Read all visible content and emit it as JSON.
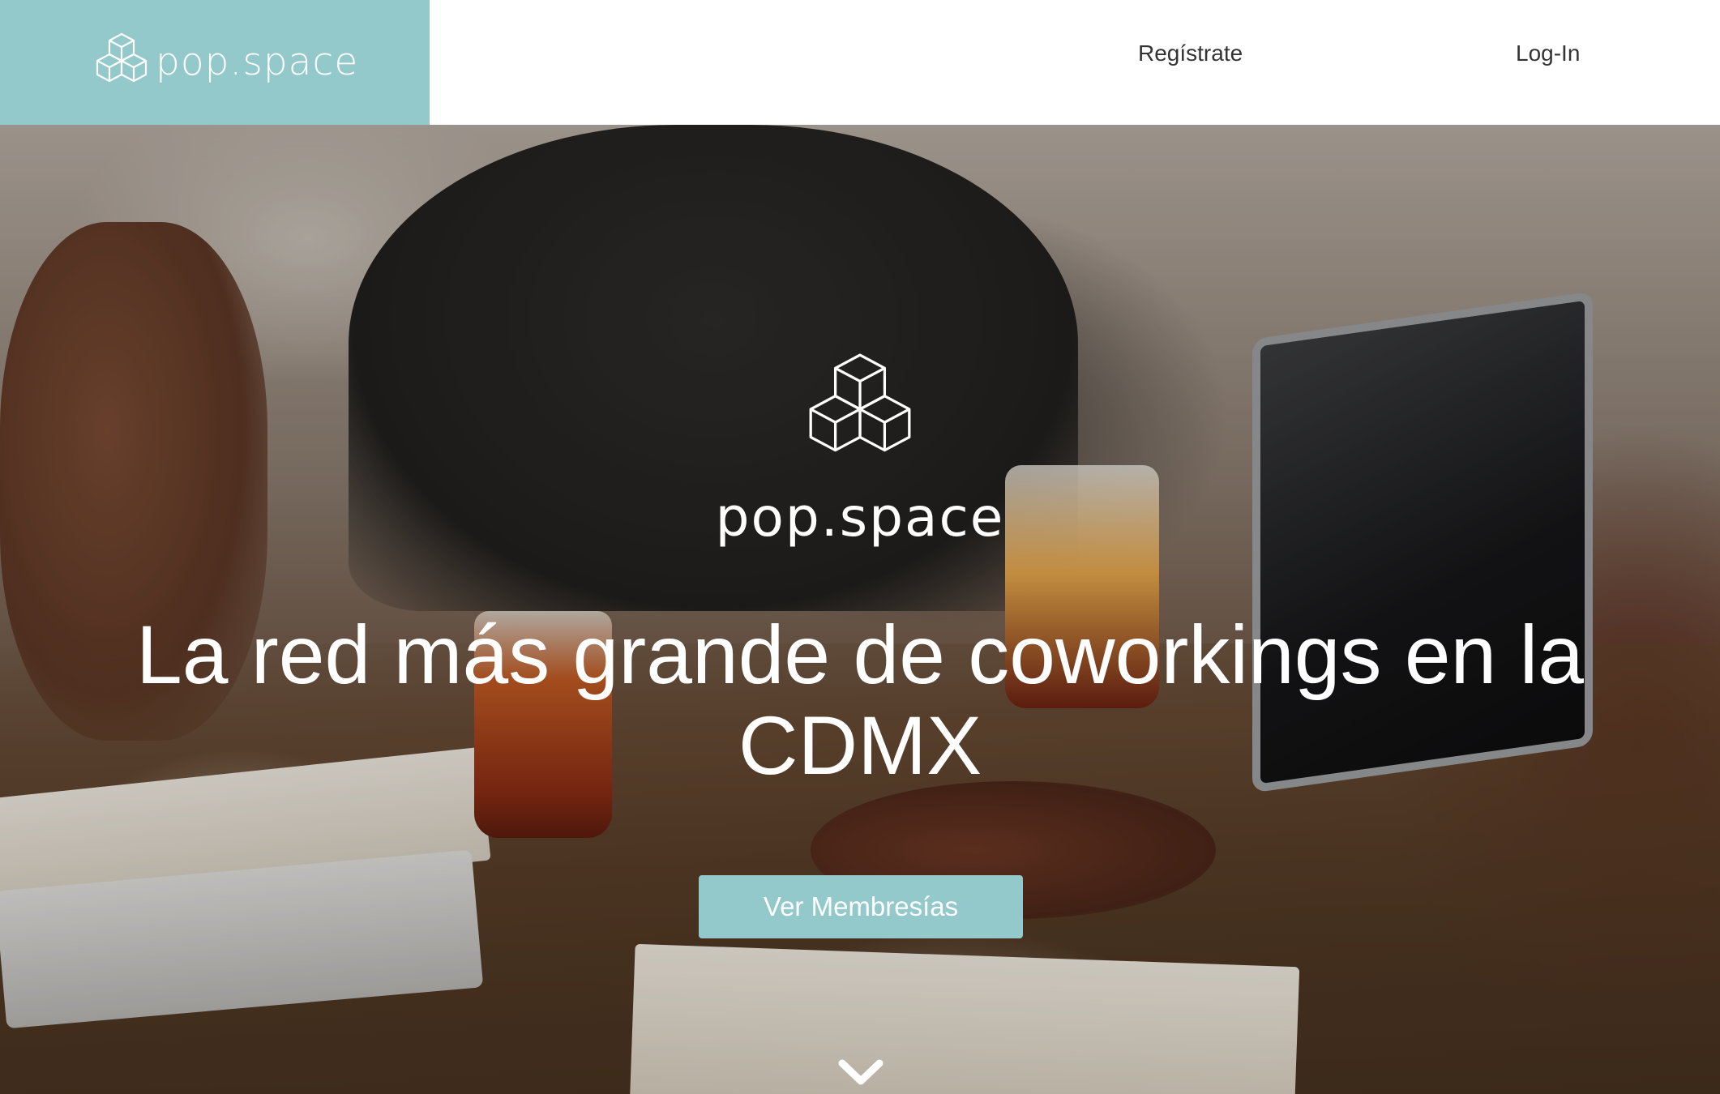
{
  "header": {
    "brand": "pop.space",
    "nav": {
      "register_label": "Regístrate",
      "login_label": "Log-In"
    }
  },
  "hero": {
    "brand": "pop.space",
    "headline": "La red más grande de coworkings en la CDMX",
    "cta_label": "Ver Membresías",
    "logo_icon": "cubes-logo-icon",
    "scroll_icon": "chevron-down-icon"
  },
  "colors": {
    "accent": "#93c9cb",
    "text_dark": "#333333",
    "white": "#ffffff"
  }
}
